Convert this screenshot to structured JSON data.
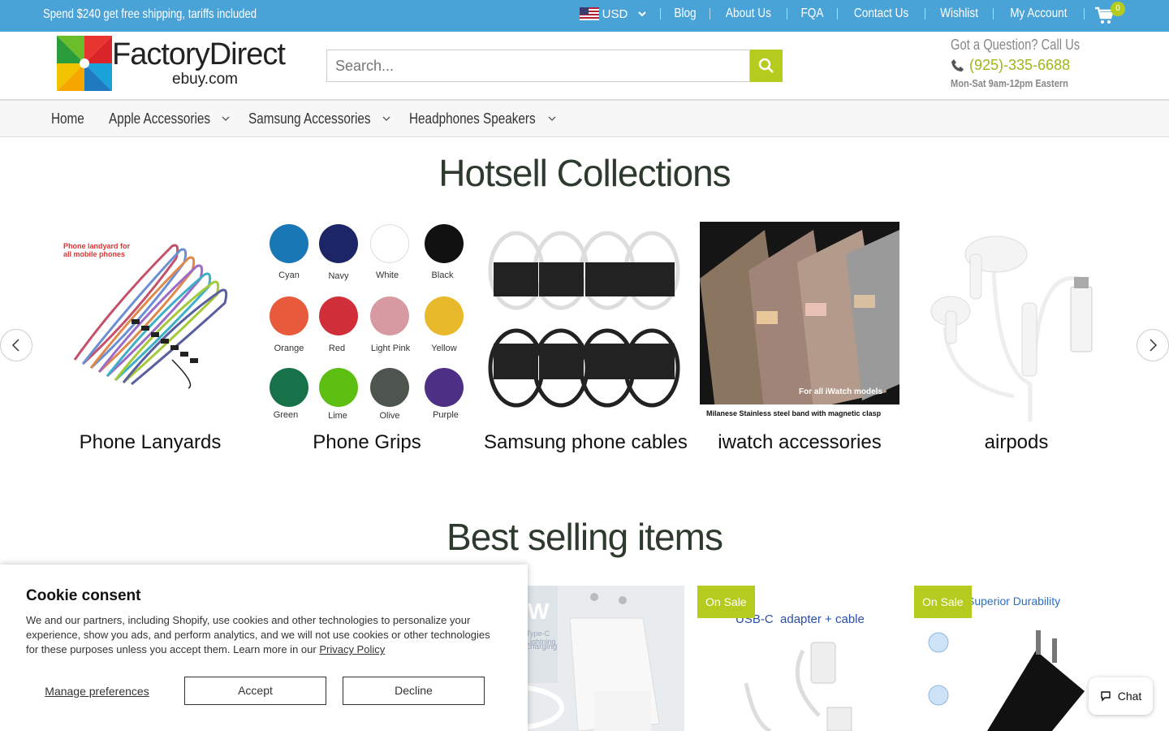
{
  "topbar": {
    "promo": "Spend $240 get free shipping, tariffs included",
    "currency": "USD",
    "links": [
      "Blog",
      "About Us",
      "FQA",
      "Contact Us",
      "Wishlist",
      "My Account"
    ],
    "cart_count": "0"
  },
  "header": {
    "logo_main": "FactoryDirect",
    "logo_sub": "ebuy.com",
    "search_placeholder": "Search...",
    "question": "Got a Question? Call Us",
    "phone": "(925)-335-6688",
    "hours": "Mon-Sat 9am-12pm Eastern"
  },
  "nav": [
    "Home",
    "Apple Accessories",
    "Samsung Accessories",
    "Headphones Speakers"
  ],
  "hotsell": {
    "title": "Hotsell Collections",
    "lanyard_caption": "Phone landyard for all mobile phones",
    "watch_caption_1": "For all iWatch models",
    "watch_caption_2": "Milanese Stainless steel band with magnetic clasp",
    "grip_colors": [
      "Cyan",
      "Navy",
      "White",
      "Black",
      "Orange",
      "Red",
      "Light Pink",
      "Yellow",
      "Green",
      "Lime",
      "Olive",
      "Purple"
    ],
    "items": [
      "Phone Lanyards",
      "Phone Grips",
      "Samsung phone cables",
      "iwatch accessories",
      "airpods"
    ]
  },
  "best": {
    "title": "Best selling items",
    "sale_label": "On Sale",
    "product_texts": [
      "W",
      "Type-C Lightning",
      "charging",
      "USB-C  adapter + cable",
      "Superior Durability"
    ]
  },
  "cookie": {
    "title": "Cookie consent",
    "text": "We and our partners, including Shopify, use cookies and other technologies to personalize your experience, show you ads, and perform analytics, and we will not use cookies or other technologies for these purposes unless you accept them. Learn more in our",
    "link": "Privacy Policy",
    "manage": "Manage preferences",
    "accept": "Accept",
    "decline": "Decline"
  },
  "chat": "Chat",
  "colors": {
    "topbar": "#4aa3d6",
    "accent": "#b5cc1f",
    "title": "#2f3a2e"
  }
}
